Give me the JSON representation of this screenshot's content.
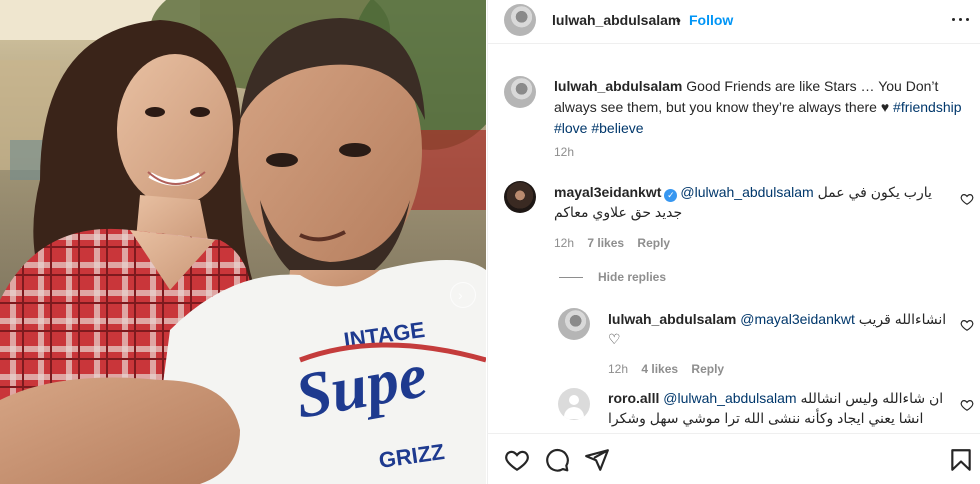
{
  "header": {
    "username": "lulwah_abdulsalam",
    "separator": "•",
    "follow_label": "Follow",
    "more_icon": "more-horizontal-icon"
  },
  "caption": {
    "username": "lulwah_abdulsalam",
    "text": "Good Friends are like Stars … You Don’t always see them, but you know they’re always there ♥",
    "hashtags": [
      "#friendship",
      "#love",
      "#believe"
    ],
    "time": "12h"
  },
  "comments": [
    {
      "username": "mayal3eidankwt",
      "verified": true,
      "mention": "@lulwah_abdulsalam",
      "text_line1": "يارب يكون في عمل",
      "text_line2": "جديد حق علاوي معاكم",
      "time": "12h",
      "likes": "7 likes",
      "reply_label": "Reply"
    }
  ],
  "hide_replies_label": "Hide replies",
  "replies": [
    {
      "username": "lulwah_abdulsalam",
      "mention": "@mayal3eidankwt",
      "text": "انشاءالله قريب",
      "emoji": "♡",
      "time": "12h",
      "likes": "4 likes",
      "reply_label": "Reply"
    },
    {
      "username": "roro.alll",
      "mention": "@lulwah_abdulsalam",
      "text_line1": "ان شاءالله وليس انشالله",
      "text_line2": "انشا يعني ايجاد وكأنه ننشى الله ترا موشي سهل وشكرا"
    }
  ],
  "actions": {
    "like_icon": "heart-icon",
    "comment_icon": "comment-icon",
    "share_icon": "send-icon",
    "save_icon": "bookmark-icon"
  },
  "carousel": {
    "next_glyph": "›"
  }
}
